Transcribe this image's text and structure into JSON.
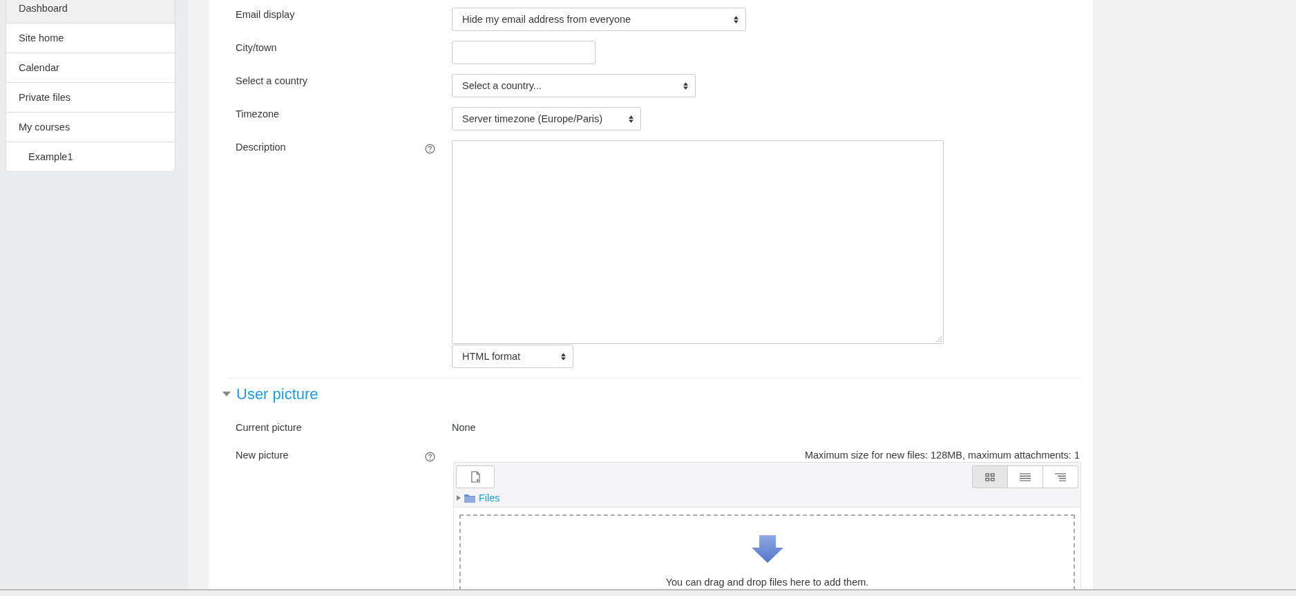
{
  "sidebar": {
    "items": [
      {
        "label": "Dashboard",
        "selected": true
      },
      {
        "label": "Site home",
        "selected": false
      },
      {
        "label": "Calendar",
        "selected": false
      },
      {
        "label": "Private files",
        "selected": false
      },
      {
        "label": "My courses",
        "selected": false,
        "children": [
          {
            "label": "Example1",
            "selected": false
          }
        ]
      }
    ]
  },
  "fields": [
    {
      "kind": "select",
      "label": "Email display",
      "value": "Hide my email address from everyone"
    },
    {
      "kind": "text",
      "label": "City/town"
    },
    {
      "kind": "select",
      "label": "Select a country",
      "value": "Select a country..."
    },
    {
      "kind": "select",
      "label": "Timezone",
      "value": "Server timezone (Europe/Paris)"
    },
    {
      "kind": "editor",
      "label": "Description",
      "help": true,
      "format": "HTML format"
    }
  ],
  "section": {
    "title": "User picture",
    "expanded": true,
    "fields": [
      {
        "kind": "static",
        "label": "Current picture",
        "value": "None"
      },
      {
        "kind": "filepicker",
        "label": "New picture",
        "help": true,
        "limits": "Maximum size for new files: 128MB, maximum attachments: 1",
        "folder": "Files",
        "views": [
          {
            "kind": "icons",
            "selected": true
          },
          {
            "kind": "list",
            "selected": false
          },
          {
            "kind": "tree",
            "selected": false
          }
        ],
        "drop_hint": "You can drag and drop files here to add them."
      }
    ]
  }
}
